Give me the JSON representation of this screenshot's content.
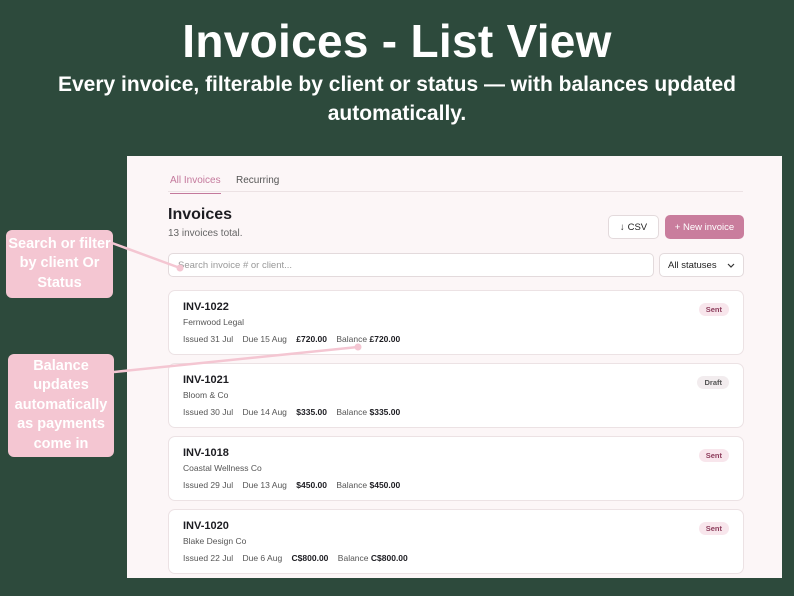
{
  "hero": {
    "title": "Invoices - List View",
    "subtitle": "Every invoice, filterable by client or status — with balances updated automatically."
  },
  "tabs": [
    {
      "label": "All Invoices",
      "active": true
    },
    {
      "label": "Recurring",
      "active": false
    }
  ],
  "header": {
    "title": "Invoices",
    "count_text": "13 invoices total.",
    "csv_label": "CSV",
    "csv_icon": "arrow-down-icon",
    "new_label": "+ New invoice"
  },
  "search": {
    "placeholder": "Search invoice # or client...",
    "value": ""
  },
  "status_filter": {
    "selected": "All statuses",
    "icon": "chevron-down-icon"
  },
  "invoices": [
    {
      "number": "INV-1022",
      "client": "Fernwood Legal",
      "issued": "Issued 31 Jul",
      "due": "Due 15 Aug",
      "amount": "£720.00",
      "balance_label": "Balance",
      "balance": "£720.00",
      "status": "Sent"
    },
    {
      "number": "INV-1021",
      "client": "Bloom & Co",
      "issued": "Issued 30 Jul",
      "due": "Due 14 Aug",
      "amount": "$335.00",
      "balance_label": "Balance",
      "balance": "$335.00",
      "status": "Draft"
    },
    {
      "number": "INV-1018",
      "client": "Coastal Wellness Co",
      "issued": "Issued 29 Jul",
      "due": "Due 13 Aug",
      "amount": "$450.00",
      "balance_label": "Balance",
      "balance": "$450.00",
      "status": "Sent"
    },
    {
      "number": "INV-1020",
      "client": "Blake Design Co",
      "issued": "Issued 22 Jul",
      "due": "Due 6 Aug",
      "amount": "C$800.00",
      "balance_label": "Balance",
      "balance": "C$800.00",
      "status": "Sent"
    }
  ],
  "callouts": [
    {
      "text": "Search or filter by client Or Status"
    },
    {
      "text": "Balance updates automatically as payments come in"
    }
  ],
  "colors": {
    "background": "#2d4a3c",
    "accent": "#c97d9d",
    "callout": "#f4c6d2"
  }
}
